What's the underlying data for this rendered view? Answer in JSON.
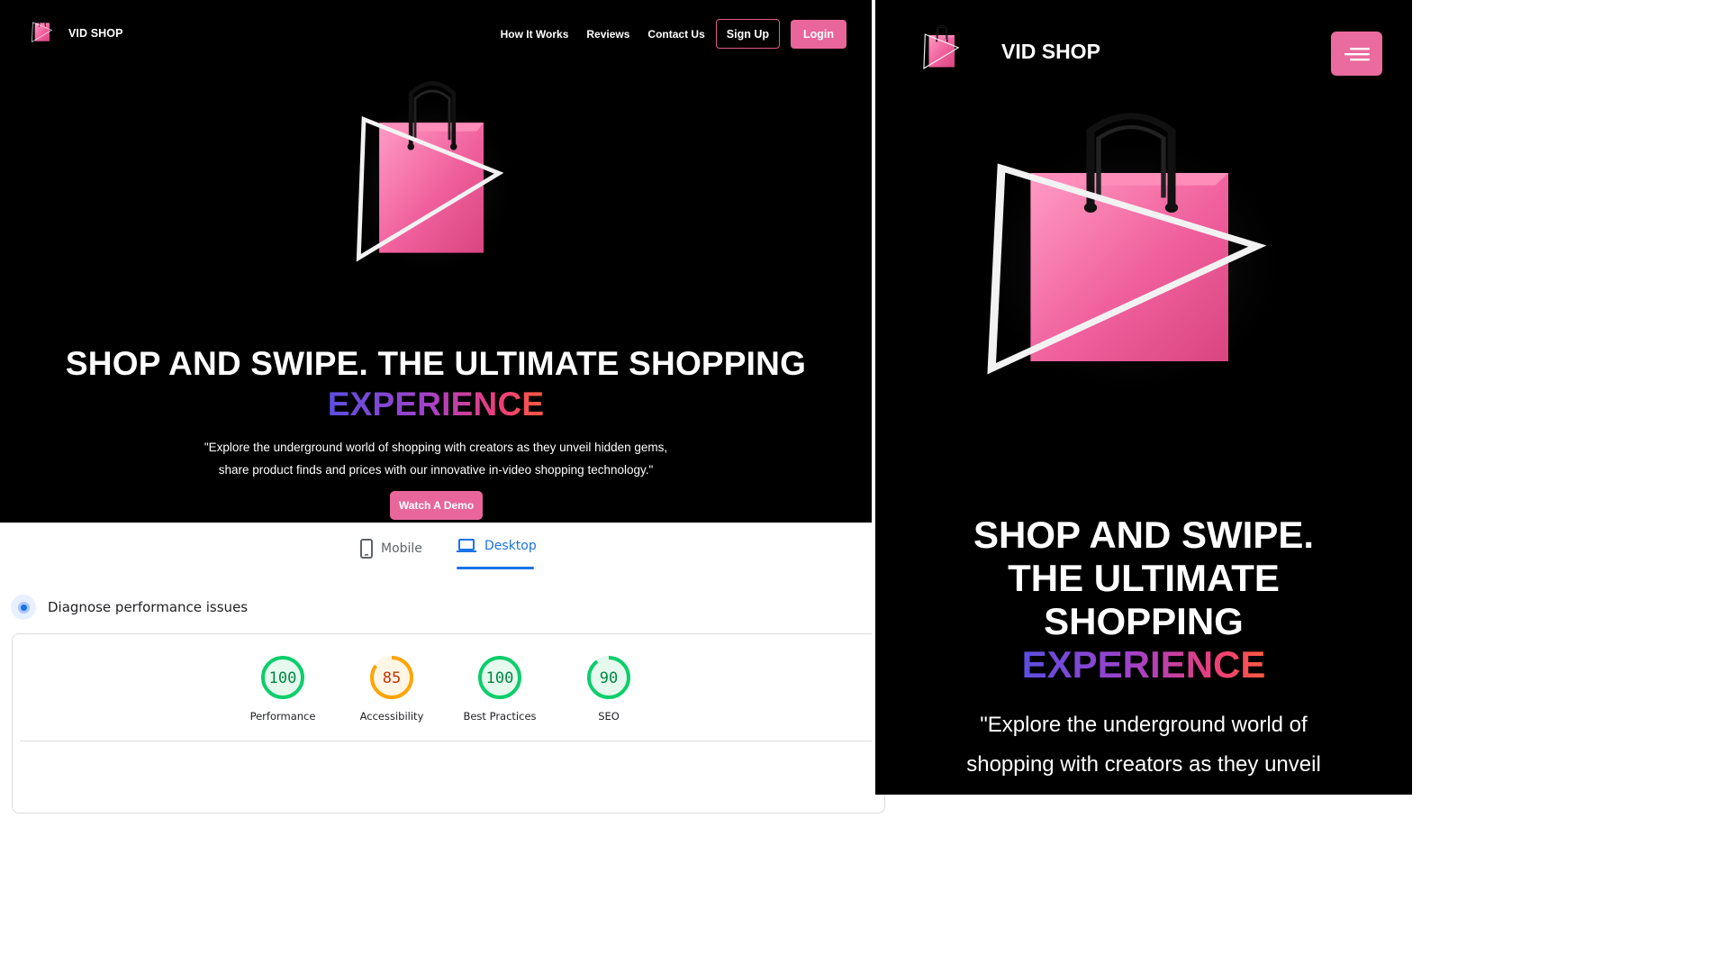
{
  "desktop": {
    "brand": "VID SHOP",
    "nav": {
      "how_it_works": "How It Works",
      "reviews": "Reviews",
      "contact_us": "Contact Us",
      "sign_up": "Sign Up",
      "login": "Login"
    },
    "hero": {
      "headline": "SHOP AND SWIPE. THE ULTIMATE SHOPPING",
      "highlight": "EXPERIENCE",
      "subtext_line1": "\"Explore the underground world of shopping with creators as they unveil hidden gems,",
      "subtext_line2": "share product finds and prices with our innovative in-video shopping technology.\"",
      "cta": "Watch A Demo"
    }
  },
  "pagespeed": {
    "tabs": {
      "mobile": "Mobile",
      "desktop": "Desktop",
      "active": "desktop"
    },
    "section_title": "Diagnose performance issues",
    "scores": [
      {
        "value": "100",
        "label": "Performance",
        "score": 100,
        "status": "pass"
      },
      {
        "value": "85",
        "label": "Accessibility",
        "score": 85,
        "status": "average"
      },
      {
        "value": "100",
        "label": "Best Practices",
        "score": 100,
        "status": "pass"
      },
      {
        "value": "90",
        "label": "SEO",
        "score": 90,
        "status": "pass"
      }
    ],
    "colors": {
      "pass": "#0cce6b",
      "pass_text": "#018642",
      "average": "#ffa400",
      "average_text": "#c33300",
      "tab_active": "#1a73e8"
    }
  },
  "mobile": {
    "brand": "VID SHOP",
    "headline_l1": "SHOP AND SWIPE.",
    "headline_l2": "THE ULTIMATE",
    "headline_l3": "SHOPPING",
    "highlight": "EXPERIENCE",
    "subtext_l1": "\"Explore the underground world of",
    "subtext_l2": "shopping with creators as they unveil"
  },
  "theme": {
    "accent_pink": "#e8669a",
    "background": "#000000"
  }
}
